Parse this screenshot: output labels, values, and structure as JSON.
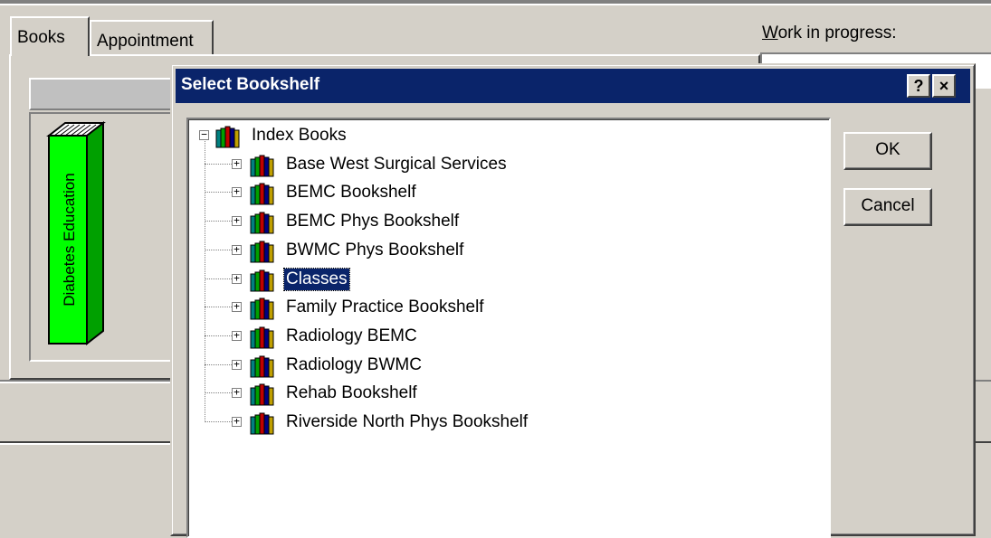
{
  "background": {
    "tabs": [
      {
        "label": "Books"
      },
      {
        "label": "Appointment"
      }
    ],
    "work_in_progress": {
      "accel": "W",
      "rest": "ork in progress:"
    },
    "book_spine": {
      "title": "Diabetes Education",
      "color": "#00ff00"
    }
  },
  "dialog": {
    "title": "Select Bookshelf",
    "help_button": "?",
    "close_button": "×",
    "ok_label": "OK",
    "cancel_label": "Cancel",
    "tree": {
      "root": {
        "label": "Index Books",
        "expander": "minus"
      },
      "children": [
        {
          "label": "Base West Surgical Services",
          "selected": false
        },
        {
          "label": "BEMC Bookshelf",
          "selected": false
        },
        {
          "label": "BEMC Phys Bookshelf",
          "selected": false
        },
        {
          "label": "BWMC Phys Bookshelf",
          "selected": false
        },
        {
          "label": "Classes",
          "selected": true
        },
        {
          "label": "Family Practice Bookshelf",
          "selected": false
        },
        {
          "label": "Radiology BEMC",
          "selected": false
        },
        {
          "label": "Radiology BWMC",
          "selected": false
        },
        {
          "label": "Rehab Bookshelf",
          "selected": false
        },
        {
          "label": "Riverside North Phys Bookshelf",
          "selected": false
        }
      ],
      "icon": "books-icon"
    }
  },
  "colors": {
    "titlebar": "#0a246a",
    "selection": "#0a246a",
    "face": "#d4d0c8"
  }
}
